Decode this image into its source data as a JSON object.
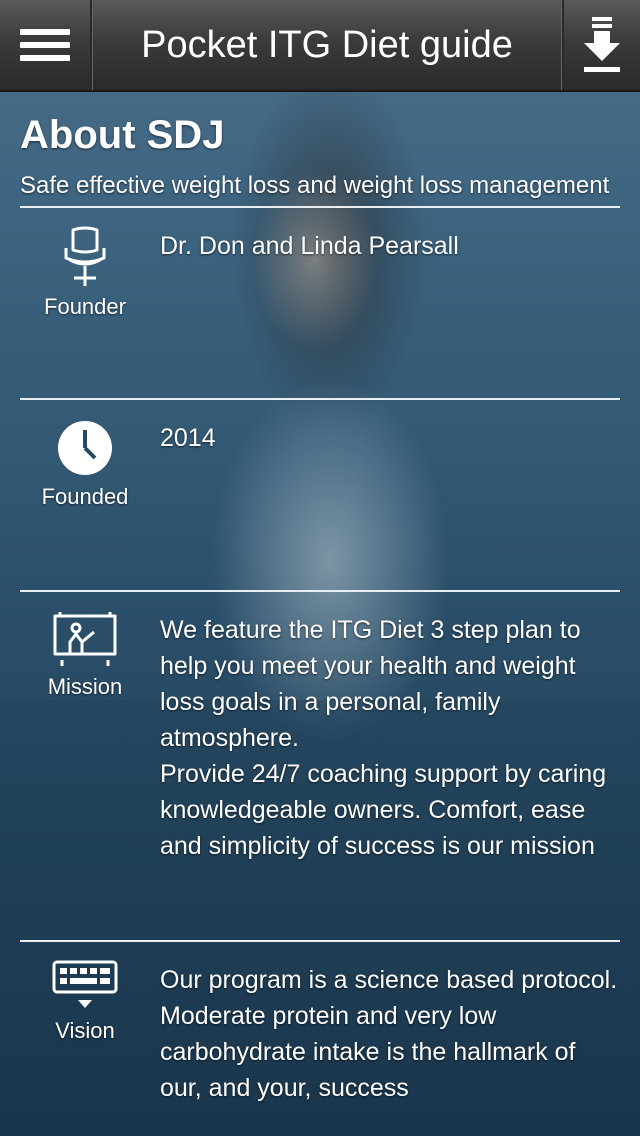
{
  "header": {
    "title": "Pocket ITG Diet guide",
    "menu_icon": "hamburger-menu-icon",
    "download_icon": "download-icon"
  },
  "about": {
    "title": "About SDJ",
    "subtitle": "Safe effective weight loss and weight loss management"
  },
  "sections": [
    {
      "icon": "chair-icon",
      "label": "Founder",
      "text": "Dr. Don and Linda Pearsall"
    },
    {
      "icon": "clock-icon",
      "label": "Founded",
      "text": "2014"
    },
    {
      "icon": "presentation-board-icon",
      "label": "Mission",
      "text": "We feature the ITG Diet 3 step plan to help you meet your health and weight loss goals in a personal, family atmosphere.\nProvide 24/7 coaching support by caring knowledgeable owners. Comfort, ease and simplicity of success is our mission"
    },
    {
      "icon": "keyboard-icon",
      "label": "Vision",
      "text": "Our program is a science based protocol. Moderate protein and very low carbohydrate intake is the hallmark of our, and your, success"
    }
  ],
  "colors": {
    "header_bg": "#3b3b3b",
    "divider": "#e8eef2",
    "text": "#ffffff"
  }
}
